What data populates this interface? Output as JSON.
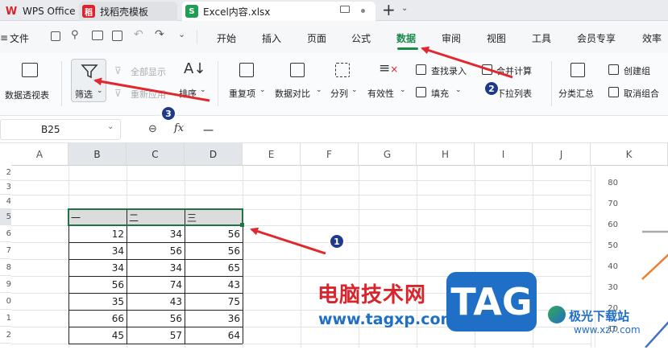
{
  "tabs": [
    {
      "label": "WPS Office",
      "icon": "wps-logo-icon",
      "color": "#d9242b"
    },
    {
      "label": "找稻壳模板",
      "icon": "docer-icon",
      "color": "#d9242b"
    },
    {
      "label": "Excel内容.xlsx",
      "icon": "spreadsheet-icon",
      "color": "#1f9d55"
    }
  ],
  "new_tab_label": "+",
  "menu": {
    "file": "文件",
    "items": [
      "开始",
      "插入",
      "页面",
      "公式",
      "数据",
      "审阅",
      "视图",
      "工具",
      "会员专享",
      "效率"
    ],
    "active": "数据",
    "accent": "#1a8a4a"
  },
  "ribbon": {
    "pivot": "数据透视表",
    "filter": "筛选",
    "show_all": "全部显示",
    "reapply": "重新应用",
    "sort": "排序",
    "duplicates": "重复项",
    "compare": "数据对比",
    "split": "分列",
    "validity": "有效性",
    "lookup": "查找录入",
    "fill": "填充",
    "consolidate": "合并计算",
    "dropdown": "下拉列表",
    "subtotal": "分类汇总",
    "group": "创建组",
    "ungroup": "取消组合"
  },
  "formula": {
    "cell_ref": "B25",
    "fx": "fx",
    "content": "一"
  },
  "columns": [
    "A",
    "B",
    "C",
    "D",
    "E",
    "F",
    "G",
    "H",
    "I",
    "J",
    "K"
  ],
  "rows": [
    "2",
    "3",
    "4",
    "5",
    "6",
    "7",
    "8",
    "9",
    "0",
    "1",
    "2"
  ],
  "table": {
    "header": [
      "一",
      "二",
      "三"
    ],
    "rows": [
      [
        12,
        34,
        56
      ],
      [
        34,
        56,
        56
      ],
      [
        34,
        34,
        65
      ],
      [
        56,
        74,
        43
      ],
      [
        35,
        43,
        75
      ],
      [
        66,
        56,
        36
      ],
      [
        45,
        57,
        64
      ]
    ]
  },
  "chart_data": {
    "type": "line",
    "y_ticks": [
      "80",
      "70",
      "60",
      "50",
      "40",
      "30",
      "20",
      "10"
    ],
    "ylim": [
      10,
      80
    ]
  },
  "annotations": [
    "1",
    "2",
    "3"
  ],
  "watermark": {
    "cn": "电脑技术网",
    "url": "www.tagxp.com",
    "badge": "TAG",
    "site": "极光下载站",
    "site_url": "www.xz7.com"
  }
}
